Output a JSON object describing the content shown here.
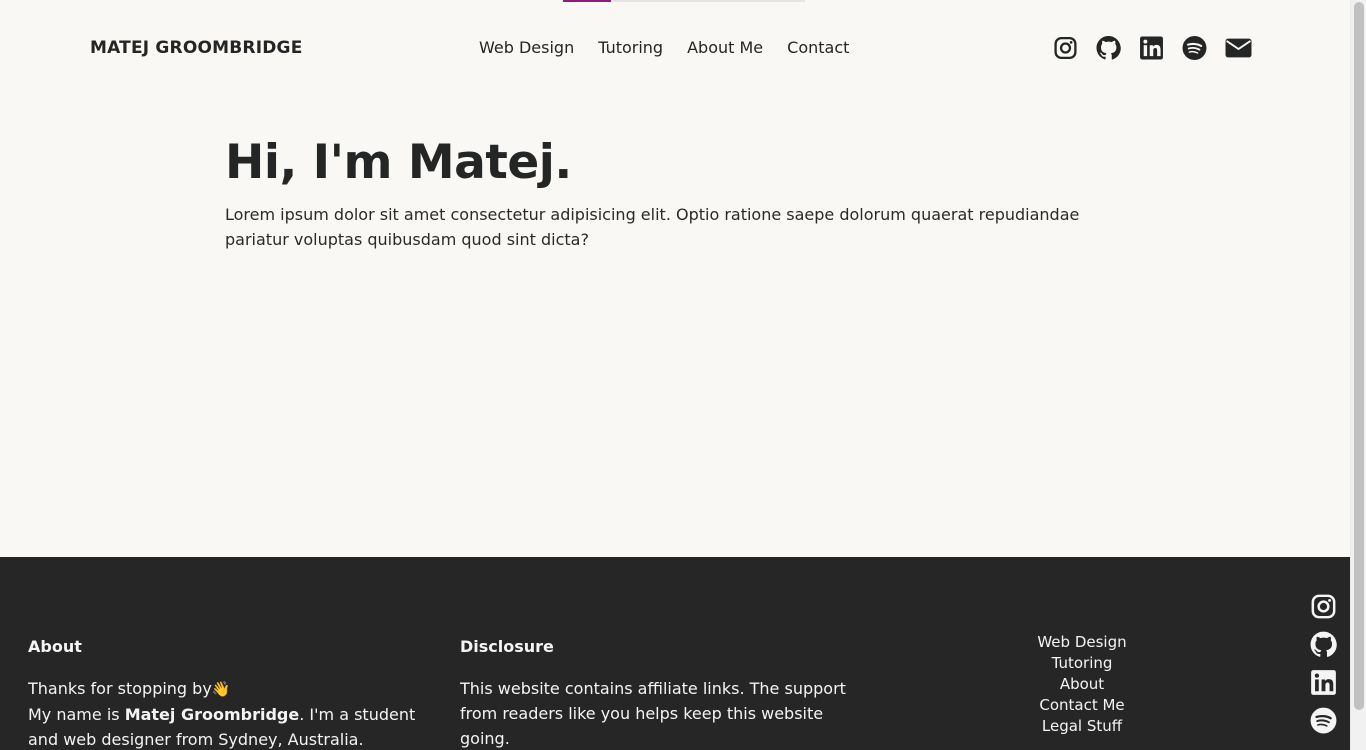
{
  "brand": "MATEJ GROOMBRIDGE",
  "nav": {
    "items": [
      "Web Design",
      "Tutoring",
      "About Me",
      "Contact"
    ]
  },
  "social": {
    "icons": [
      "instagram-icon",
      "github-icon",
      "linkedin-icon",
      "spotify-icon",
      "email-icon"
    ]
  },
  "hero": {
    "title": "Hi, I'm Matej.",
    "text": "Lorem ipsum dolor sit amet consectetur adipisicing elit. Optio ratione saepe dolorum quaerat repudiandae pariatur voluptas quibusdam quod sint dicta?"
  },
  "footer": {
    "about": {
      "heading": "About",
      "line1": "Thanks for stopping by",
      "wave": "👋",
      "line2_prefix": "My name is ",
      "name": "Matej Groombridge",
      "line2_suffix": ". I'm a student and web designer from Sydney, Australia."
    },
    "disclosure": {
      "heading": "Disclosure",
      "text": "This website contains affiliate links. The support from readers like you helps keep this website going."
    },
    "links": [
      "Web Design",
      "Tutoring",
      "About",
      "Contact Me",
      "Legal Stuff"
    ],
    "side_icons": [
      "instagram-icon",
      "github-icon",
      "linkedin-icon",
      "spotify-icon"
    ]
  },
  "colors": {
    "background": "#f9f8f5",
    "text": "#242525",
    "footer_bg": "#252625",
    "accent": "#8a1f7a"
  },
  "scroll_progress": 0.2
}
